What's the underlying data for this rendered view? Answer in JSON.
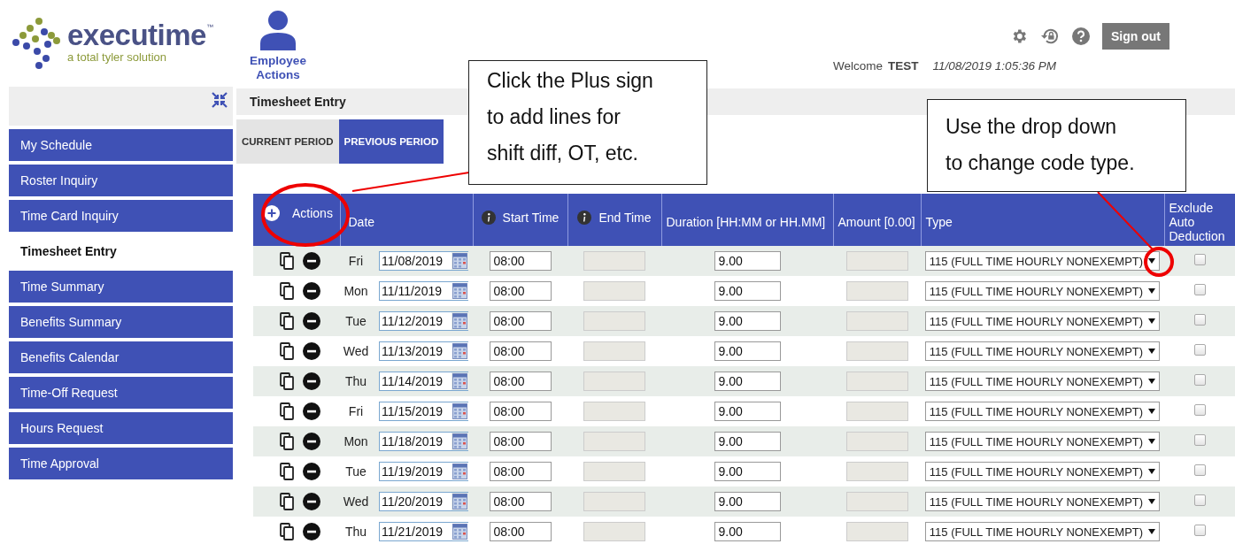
{
  "header": {
    "brand": "executime",
    "trademark": "™",
    "tagline": "a total tyler solution",
    "employee_actions": "Employee Actions",
    "sign_out": "Sign out",
    "welcome": "Welcome",
    "user": "TEST",
    "timestamp": "11/08/2019 1:05:36 PM"
  },
  "sidebar": {
    "items": [
      {
        "label": "My Schedule",
        "selected": false
      },
      {
        "label": "Roster Inquiry",
        "selected": false
      },
      {
        "label": "Time Card Inquiry",
        "selected": false
      },
      {
        "label": "Timesheet Entry",
        "selected": true
      },
      {
        "label": "Time Summary",
        "selected": false
      },
      {
        "label": "Benefits Summary",
        "selected": false
      },
      {
        "label": "Benefits Calendar",
        "selected": false
      },
      {
        "label": "Time-Off Request",
        "selected": false
      },
      {
        "label": "Hours Request",
        "selected": false
      },
      {
        "label": "Time Approval",
        "selected": false
      }
    ]
  },
  "page_title": "Timesheet Entry",
  "tabs": [
    {
      "label": "CURRENT PERIOD",
      "selected": false
    },
    {
      "label": "PREVIOUS PERIOD",
      "selected": true
    }
  ],
  "table": {
    "columns": [
      {
        "label": "Actions",
        "kind": "actions"
      },
      {
        "label": "Date",
        "kind": "plain"
      },
      {
        "label": "Start Time",
        "kind": "info"
      },
      {
        "label": "End Time",
        "kind": "info"
      },
      {
        "label": "Duration [HH:MM or HH.MM]",
        "kind": "plain"
      },
      {
        "label": "Amount [0.00]",
        "kind": "plain"
      },
      {
        "label": "Type",
        "kind": "plain"
      },
      {
        "label": "Exclude Auto Deduction",
        "kind": "plain"
      }
    ],
    "rows": [
      {
        "day": "Fri",
        "date": "11/08/2019",
        "start_time": "08:00",
        "end_time_disabled": true,
        "duration": "9.00",
        "amount_disabled": true,
        "type": "115 (FULL TIME HOURLY NONEXEMPT)",
        "exclude": false
      },
      {
        "day": "Mon",
        "date": "11/11/2019",
        "start_time": "08:00",
        "end_time_disabled": true,
        "duration": "9.00",
        "amount_disabled": true,
        "type": "115 (FULL TIME HOURLY NONEXEMPT)",
        "exclude": false
      },
      {
        "day": "Tue",
        "date": "11/12/2019",
        "start_time": "08:00",
        "end_time_disabled": true,
        "duration": "9.00",
        "amount_disabled": true,
        "type": "115 (FULL TIME HOURLY NONEXEMPT)",
        "exclude": false
      },
      {
        "day": "Wed",
        "date": "11/13/2019",
        "start_time": "08:00",
        "end_time_disabled": true,
        "duration": "9.00",
        "amount_disabled": true,
        "type": "115 (FULL TIME HOURLY NONEXEMPT)",
        "exclude": false
      },
      {
        "day": "Thu",
        "date": "11/14/2019",
        "start_time": "08:00",
        "end_time_disabled": true,
        "duration": "9.00",
        "amount_disabled": true,
        "type": "115 (FULL TIME HOURLY NONEXEMPT)",
        "exclude": false
      },
      {
        "day": "Fri",
        "date": "11/15/2019",
        "start_time": "08:00",
        "end_time_disabled": true,
        "duration": "9.00",
        "amount_disabled": true,
        "type": "115 (FULL TIME HOURLY NONEXEMPT)",
        "exclude": false
      },
      {
        "day": "Mon",
        "date": "11/18/2019",
        "start_time": "08:00",
        "end_time_disabled": true,
        "duration": "9.00",
        "amount_disabled": true,
        "type": "115 (FULL TIME HOURLY NONEXEMPT)",
        "exclude": false
      },
      {
        "day": "Tue",
        "date": "11/19/2019",
        "start_time": "08:00",
        "end_time_disabled": true,
        "duration": "9.00",
        "amount_disabled": true,
        "type": "115 (FULL TIME HOURLY NONEXEMPT)",
        "exclude": false
      },
      {
        "day": "Wed",
        "date": "11/20/2019",
        "start_time": "08:00",
        "end_time_disabled": true,
        "duration": "9.00",
        "amount_disabled": true,
        "type": "115 (FULL TIME HOURLY NONEXEMPT)",
        "exclude": false
      },
      {
        "day": "Thu",
        "date": "11/21/2019",
        "start_time": "08:00",
        "end_time_disabled": true,
        "duration": "9.00",
        "amount_disabled": true,
        "type": "115 (FULL TIME HOURLY NONEXEMPT)",
        "exclude": false
      }
    ]
  },
  "callouts": [
    {
      "lines": [
        "Click the Plus sign",
        "to add lines for",
        "shift diff, OT, etc."
      ]
    },
    {
      "lines": [
        "Use the drop down",
        "to change code type."
      ]
    }
  ]
}
